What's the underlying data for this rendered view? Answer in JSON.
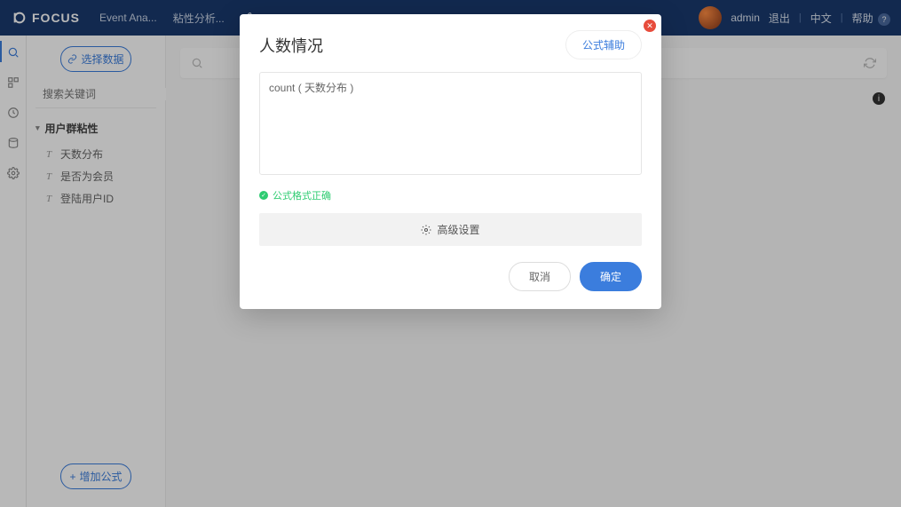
{
  "brand": "FOCUS",
  "header": {
    "tabs": [
      "Event Ana...",
      "粘性分析..."
    ],
    "user": "admin",
    "logout": "退出",
    "lang": "中文",
    "help": "帮助",
    "help_badge": "?"
  },
  "sidebar": {
    "select_data": "选择数据",
    "search_placeholder": "搜索关键词",
    "group_title": "用户群粘性",
    "fields": [
      "天数分布",
      "是否为会员",
      "登陆用户ID"
    ],
    "add_formula": "增加公式"
  },
  "modal": {
    "title": "人数情况",
    "helper_btn": "公式辅助",
    "formula_value": "count ( 天数分布 )",
    "valid_text": "公式格式正确",
    "advanced": "高级设置",
    "cancel": "取消",
    "confirm": "确定"
  }
}
